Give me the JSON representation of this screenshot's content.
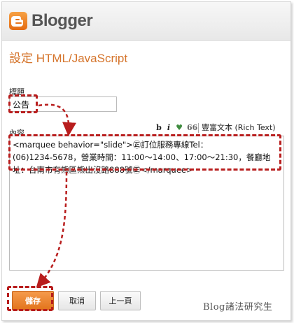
{
  "brand": {
    "name": "Blogger",
    "accent": "#e46b12"
  },
  "page": {
    "title": "設定 HTML/JavaScript"
  },
  "form": {
    "title_label": "標題",
    "title_value": "公告",
    "content_label": "內容",
    "content_lines": [
      "<marquee behavior=\"slide\">㊣訂位服務專線Tel：",
      "(06)1234-5678，營業時間：11:00～14:00、17:00～21:30，餐廳地",
      "址：台南市有熊區熊出沒路888號㊣</marquee>"
    ]
  },
  "toolbar": {
    "bold": "b",
    "italic": "i",
    "heart_icon": "heart-icon",
    "quote": "66",
    "rich_text": "豐富文本 (Rich Text)"
  },
  "buttons": {
    "save": "儲存",
    "cancel": "取消",
    "prev": "上一頁"
  },
  "watermark": "Blog諸法研究生",
  "annotation_color": "#b81d1d"
}
